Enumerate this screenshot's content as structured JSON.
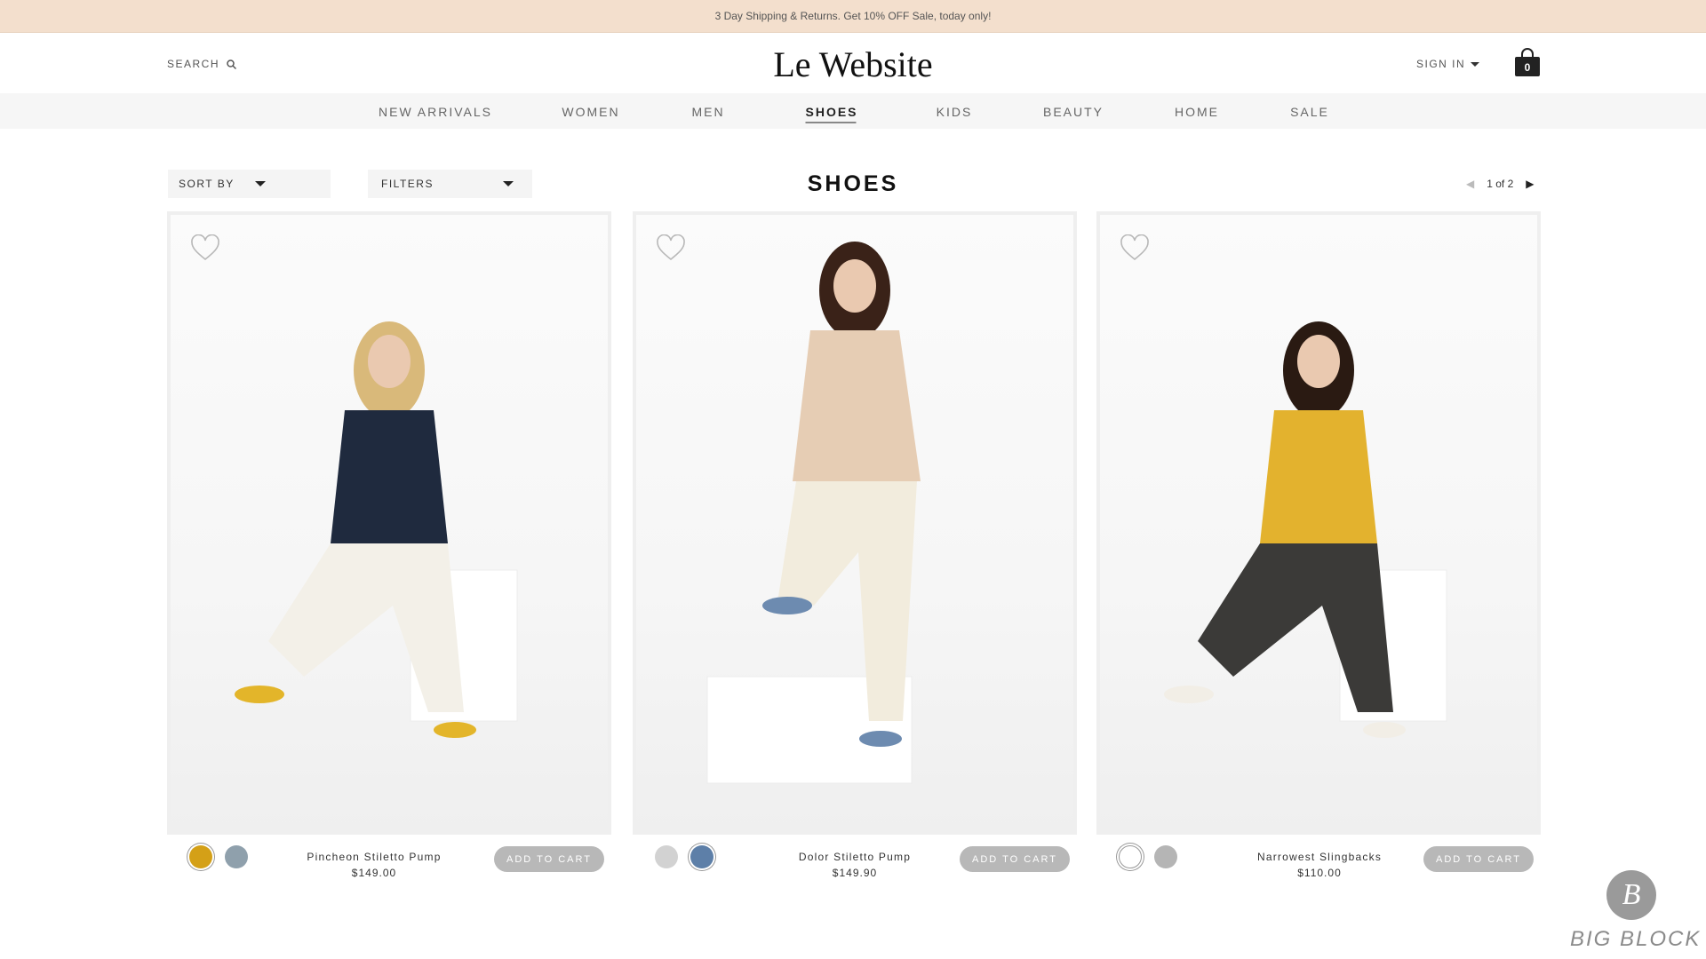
{
  "promo": {
    "text": "3 Day Shipping & Returns. Get 10% OFF Sale, today only!"
  },
  "header": {
    "search_label": "SEARCH",
    "logo": "Le Website",
    "signin_label": "SIGN IN",
    "cart_count": "0"
  },
  "nav": {
    "items": [
      {
        "label": "NEW ARRIVALS"
      },
      {
        "label": "WOMEN"
      },
      {
        "label": "MEN"
      },
      {
        "label": "SHOES"
      },
      {
        "label": "KIDS"
      },
      {
        "label": "BEAUTY"
      },
      {
        "label": "HOME"
      },
      {
        "label": "SALE"
      }
    ],
    "active": "SHOES"
  },
  "toolbar": {
    "sort_label": "SORT BY",
    "filters_label": "FILTERS",
    "page_title": "SHOES",
    "pager_text": "1 of 2"
  },
  "products": [
    {
      "name": "Pincheon Stiletto Pump",
      "price": "$149.00",
      "add_label": "ADD TO CART",
      "swatches": [
        "#d4a017",
        "#8fa0ac"
      ],
      "selected_swatch": 0,
      "top_color": "#1f2a3e",
      "bottom_color": "#f3f0e8",
      "shoe_color": "#e3b52a",
      "hair_color": "#d9b97a"
    },
    {
      "name": "Dolor Stiletto Pump",
      "price": "$149.90",
      "add_label": "ADD TO CART",
      "swatches": [
        "#d2d2d2",
        "#5d7fa8"
      ],
      "selected_swatch": 1,
      "top_color": "#e6cdb4",
      "bottom_color": "#f2ecdd",
      "shoe_color": "#6d8bb0",
      "hair_color": "#3a2218"
    },
    {
      "name": "Narrowest Slingbacks",
      "price": "$110.00",
      "add_label": "ADD TO CART",
      "swatches": [
        "#ffffff",
        "#b5b5b5"
      ],
      "selected_swatch": 0,
      "top_color": "#e3b22e",
      "bottom_color": "#3b3a38",
      "shoe_color": "#f2eee6",
      "hair_color": "#2a1a12"
    }
  ],
  "watermark": {
    "text": "BIG BLOCK",
    "logo_letter": "B"
  },
  "icons": {
    "search": "search-icon",
    "cart": "shopping-bag-icon",
    "heart": "heart-outline-icon",
    "sort_caret": "caret-down-icon",
    "pager_prev": "chevron-left-icon",
    "pager_next": "chevron-right-icon"
  }
}
